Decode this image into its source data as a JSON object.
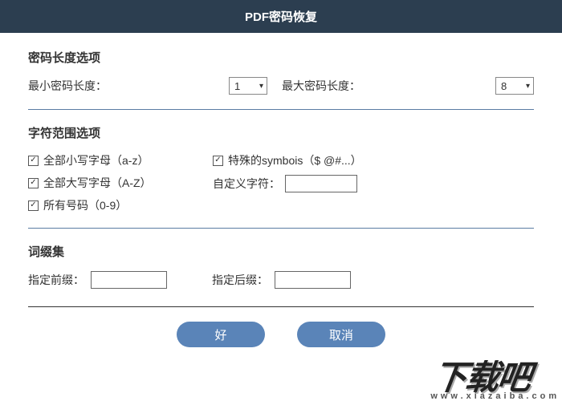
{
  "header": {
    "title": "PDF密码恢复"
  },
  "length": {
    "section_title": "密码长度选项",
    "min_label": "最小密码长度：",
    "min_value": "1",
    "max_label": "最大密码长度：",
    "max_value": "8"
  },
  "charset": {
    "section_title": "字符范围选项",
    "lowercase": "全部小写字母（a-z）",
    "uppercase": "全部大写字母（A-Z）",
    "digits": "所有号码（0-9）",
    "symbols": "特殊的symbois（$ @#...）",
    "custom_label": "自定义字符：",
    "custom_value": ""
  },
  "affix": {
    "section_title": "词缀集",
    "prefix_label": "指定前缀：",
    "prefix_value": "",
    "suffix_label": "指定后缀：",
    "suffix_value": ""
  },
  "buttons": {
    "ok": "好",
    "cancel": "取消"
  },
  "watermark": {
    "main": "下载吧",
    "sub": "www.xiazaiba.com"
  },
  "icons": {
    "check": "✓",
    "caret": "▾"
  }
}
